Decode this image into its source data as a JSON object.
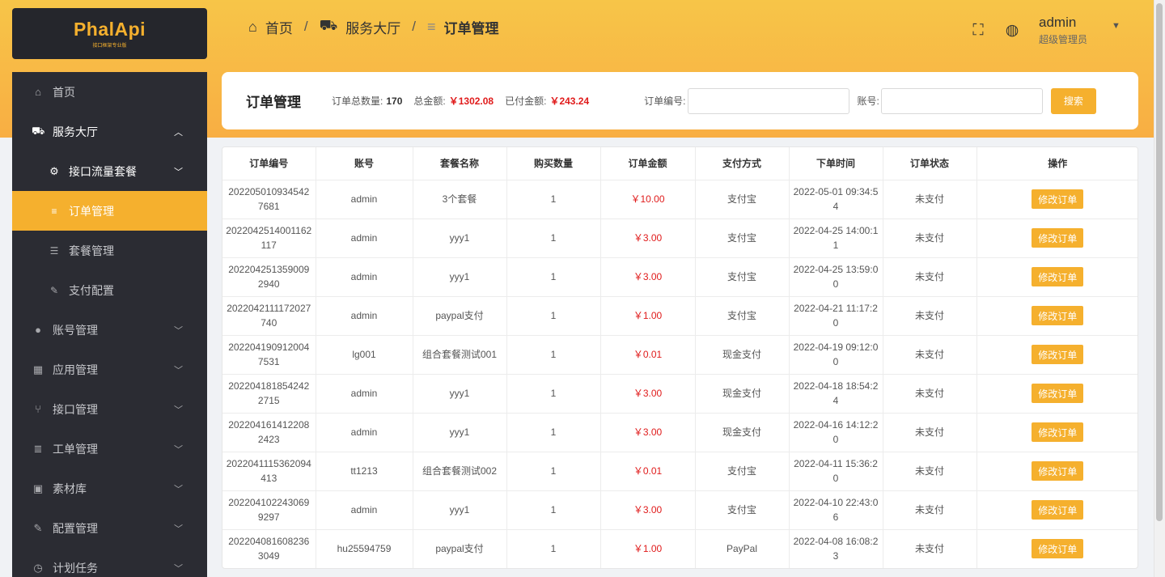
{
  "brand": {
    "logo_text": "PhalApi",
    "logo_sub": "接口框架专业版"
  },
  "sidebar": {
    "items": [
      {
        "label": "首页",
        "icon": "home-icon",
        "glyph": "⌂"
      },
      {
        "label": "服务大厅",
        "icon": "cart-icon",
        "glyph": "🛒",
        "open": true
      },
      {
        "label": "接口流量套餐",
        "icon": "traffic-icon",
        "glyph": "⚙",
        "open": true
      },
      {
        "label": "订单管理",
        "icon": "list-icon",
        "glyph": "≡",
        "active": true
      },
      {
        "label": "套餐管理",
        "icon": "package-icon",
        "glyph": "☰"
      },
      {
        "label": "支付配置",
        "icon": "wrench-icon",
        "glyph": "✎"
      },
      {
        "label": "账号管理",
        "icon": "user-icon",
        "glyph": "●"
      },
      {
        "label": "应用管理",
        "icon": "grid-icon",
        "glyph": "▦"
      },
      {
        "label": "接口管理",
        "icon": "branch-icon",
        "glyph": "⑂"
      },
      {
        "label": "工单管理",
        "icon": "lines-icon",
        "glyph": "≣"
      },
      {
        "label": "素材库",
        "icon": "image-icon",
        "glyph": "▣"
      },
      {
        "label": "配置管理",
        "icon": "settings-icon",
        "glyph": "✎"
      },
      {
        "label": "计划任务",
        "icon": "clock-icon",
        "glyph": "◷"
      }
    ]
  },
  "breadcrumb": {
    "home": "首页",
    "hall": "服务大厅",
    "current": "订单管理",
    "sep": "/"
  },
  "header": {
    "user_name": "admin",
    "user_role": "超级管理员"
  },
  "search": {
    "title": "订单管理",
    "total_count_label": "订单总数量:",
    "total_count": "170",
    "total_amount_label": "总金额:",
    "total_amount": "￥1302.08",
    "paid_amount_label": "已付金额:",
    "paid_amount": "￥243.24",
    "order_no_label": "订单编号:",
    "order_no_value": "",
    "account_label": "账号:",
    "account_value": "",
    "search_button": "搜索"
  },
  "table": {
    "columns": [
      "订单编号",
      "账号",
      "套餐名称",
      "购买数量",
      "订单金额",
      "支付方式",
      "下单时间",
      "订单状态",
      "操作"
    ],
    "action_label": "修改订单",
    "rows": [
      [
        "2022050109345427681",
        "admin",
        "3个套餐",
        "1",
        "￥10.00",
        "支付宝",
        "2022-05-01 09:34:54",
        "未支付"
      ],
      [
        "2022042514001162117",
        "admin",
        "yyy1",
        "1",
        "￥3.00",
        "支付宝",
        "2022-04-25 14:00:11",
        "未支付"
      ],
      [
        "2022042513590092940",
        "admin",
        "yyy1",
        "1",
        "￥3.00",
        "支付宝",
        "2022-04-25 13:59:00",
        "未支付"
      ],
      [
        "2022042111172027740",
        "admin",
        "paypal支付",
        "1",
        "￥1.00",
        "支付宝",
        "2022-04-21 11:17:20",
        "未支付"
      ],
      [
        "2022041909120047531",
        "lg001",
        "组合套餐测试001",
        "1",
        "￥0.01",
        "现金支付",
        "2022-04-19 09:12:00",
        "未支付"
      ],
      [
        "2022041818542422715",
        "admin",
        "yyy1",
        "1",
        "￥3.00",
        "现金支付",
        "2022-04-18 18:54:24",
        "未支付"
      ],
      [
        "2022041614122082423",
        "admin",
        "yyy1",
        "1",
        "￥3.00",
        "现金支付",
        "2022-04-16 14:12:20",
        "未支付"
      ],
      [
        "2022041115362094413",
        "tt1213",
        "组合套餐测试002",
        "1",
        "￥0.01",
        "支付宝",
        "2022-04-11 15:36:20",
        "未支付"
      ],
      [
        "2022041022430699297",
        "admin",
        "yyy1",
        "1",
        "￥3.00",
        "支付宝",
        "2022-04-10 22:43:06",
        "未支付"
      ],
      [
        "2022040816082363049",
        "hu25594759",
        "paypal支付",
        "1",
        "￥1.00",
        "PayPal",
        "2022-04-08 16:08:23",
        "未支付"
      ]
    ]
  },
  "colors": {
    "accent": "#f5b02e",
    "sidebar_bg": "#2b2c33",
    "amount_red": "#e01b1b"
  }
}
